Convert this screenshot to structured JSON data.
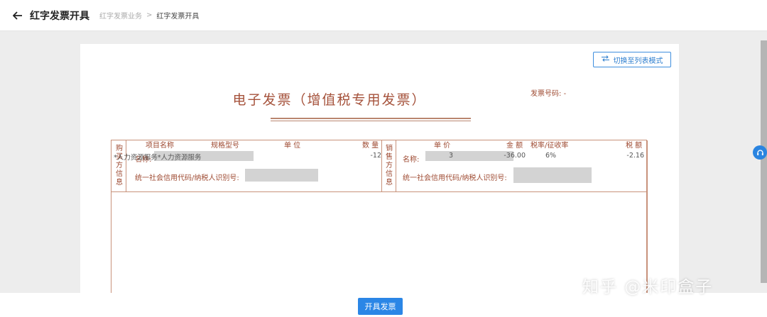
{
  "header": {
    "title": "红字发票开具",
    "breadcrumb": [
      "红字发票业务",
      "红字发票开具"
    ],
    "separator": ">"
  },
  "toolbar": {
    "switch_label": "切换至列表模式",
    "switch_icon": "swap-icon"
  },
  "invoice": {
    "title": "电子发票（增值税专用发票）",
    "number_label": "发票号码:",
    "number_value": "-",
    "buyer": {
      "side_label": [
        "购",
        "买",
        "方",
        "信",
        "息"
      ],
      "name_label": "名称:",
      "tax_id_label": "统一社会信用代码/纳税人识别号:"
    },
    "seller": {
      "side_label": [
        "销",
        "售",
        "方",
        "信",
        "息"
      ],
      "name_label": "名称:",
      "tax_id_label": "统一社会信用代码/纳税人识别号:"
    },
    "columns": [
      "项目名称",
      "规格型号",
      "单 位",
      "数 量",
      "单 价",
      "金 额",
      "税率/征收率",
      "税 额"
    ],
    "items": [
      {
        "name": "*人力资源服务*人力资源服务",
        "spec": "",
        "unit": "",
        "qty": "-12",
        "price": "3",
        "amount": "-36.00",
        "rate": "6%",
        "tax": "-2.16"
      }
    ]
  },
  "footer": {
    "issue_label": "开具发票"
  },
  "watermark": "知乎 @米印盒子"
}
